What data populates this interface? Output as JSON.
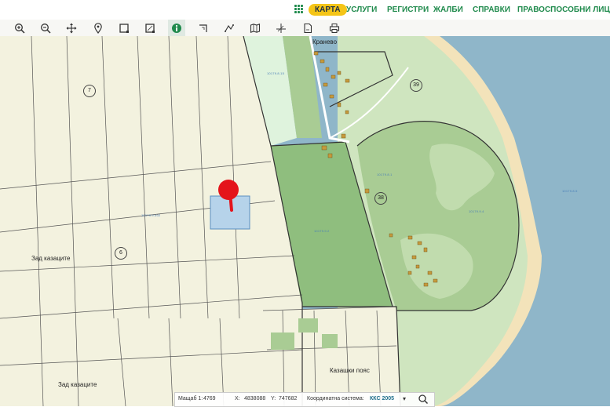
{
  "nav": {
    "items": [
      {
        "label": "КАРТА",
        "active": true
      },
      {
        "label": "УСЛУГИ",
        "active": false
      },
      {
        "label": "РЕГИСТРИ",
        "active": false
      },
      {
        "label": "ЖАЛБИ",
        "active": false
      },
      {
        "label": "СПРАВКИ",
        "active": false
      },
      {
        "label": "ПРАВОСПОСОБНИ ЛИЦА",
        "active": false
      }
    ],
    "menu_icon": "apps-grid-icon",
    "accent": "#1f8a4c",
    "active_bg": "#f5c518"
  },
  "toolbar": {
    "tools": [
      "zoom-in-icon",
      "zoom-out-icon",
      "pan-icon",
      "location-pin-icon",
      "select-rectangle-icon",
      "select-area-icon",
      "info-icon",
      "measure-angle-icon",
      "measure-distance-icon",
      "layers-map-icon",
      "coordinates-icon",
      "document-icon",
      "print-icon"
    ],
    "active_tool": "info-icon"
  },
  "map": {
    "places": [
      {
        "id": "zad-kazashte-1",
        "text": "Зад казаците"
      },
      {
        "id": "zad-kazashte-2",
        "text": "Зад казаците"
      },
      {
        "id": "kazashki-poyas",
        "text": "Казашки пояс"
      },
      {
        "id": "kranevo",
        "text": "Кранево"
      }
    ],
    "parcel_numbers": [
      "7",
      "6",
      "39",
      "38"
    ],
    "parcel_labels": [
      "10179.9.602",
      "10179.9.2",
      "10179.8.15",
      "10179.8.1",
      "10179.9.4",
      "10179.8.5"
    ],
    "colors": {
      "field": "#f3f2df",
      "forest": "#a9cc94",
      "forest_dark": "#86b877",
      "sea": "#8fb6c9",
      "sand": "#f3e3ba",
      "selected": "#b6d3ea",
      "pin": "#e4141b"
    }
  },
  "status": {
    "scale_label": "Мащаб 1:",
    "scale_value": "4769",
    "x_label": "X:",
    "x_value": "4838088",
    "y_label": "Y:",
    "y_value": "747682",
    "crs_label": "Координатна система:",
    "crs_value": "ККС 2005"
  }
}
